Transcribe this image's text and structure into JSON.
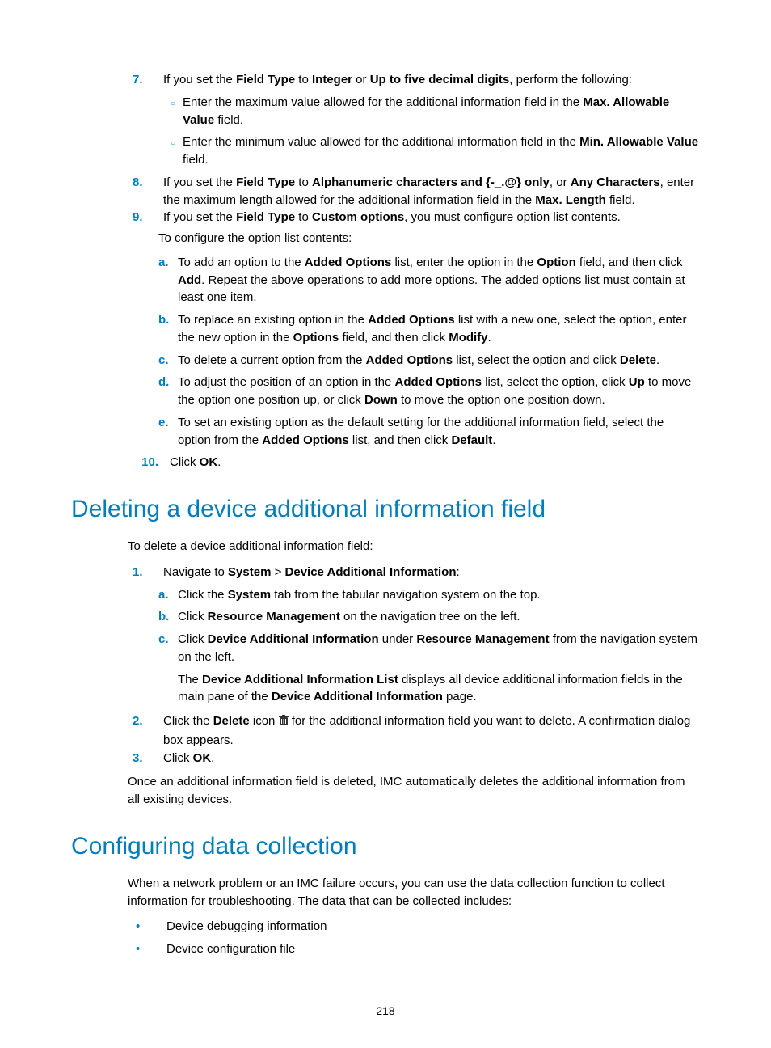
{
  "page_number": "218",
  "step7": {
    "num": "7.",
    "text_pre": "If you set the ",
    "b1": "Field Type",
    "text_mid1": " to ",
    "b2": "Integer",
    "text_mid2": " or ",
    "b3": "Up to five decimal digits",
    "text_post": ", perform the following:",
    "sub_a_pre": "Enter the maximum value allowed for the additional information field in the ",
    "sub_a_b": "Max. Allowable Value",
    "sub_a_post": " field.",
    "sub_b_pre": "Enter the minimum value allowed for the additional information field in the ",
    "sub_b_b": "Min. Allowable Value",
    "sub_b_post": " field."
  },
  "step8": {
    "num": "8.",
    "pre": "If you set the ",
    "b1": "Field Type",
    "mid1": " to ",
    "b2": "Alphanumeric characters and {-_.@} only",
    "mid2": ", or ",
    "b3": "Any Characters",
    "mid3": ", enter the maximum length allowed for the additional information field in the ",
    "b4": "Max. Length",
    "post": " field."
  },
  "step9": {
    "num": "9.",
    "pre": "If you set the ",
    "b1": "Field Type",
    "mid": " to ",
    "b2": "Custom options",
    "post": ", you must configure option list contents.",
    "intro": "To configure the option list contents:",
    "a": {
      "m": "a.",
      "t1": "To add an option to the ",
      "b1": "Added Options",
      "t2": " list, enter the option in the ",
      "b2": "Option",
      "t3": " field, and then click ",
      "b3": "Add",
      "t4": ". Repeat the above operations to add more options. The added options list must contain at least one item."
    },
    "b": {
      "m": "b.",
      "t1": "To replace an existing option in the ",
      "b1": "Added Options",
      "t2": " list with a new one, select the option, enter the new option in the ",
      "b2": "Options",
      "t3": " field, and then click ",
      "b3": "Modify",
      "t4": "."
    },
    "c": {
      "m": "c.",
      "t1": "To delete a current option from the ",
      "b1": "Added Options",
      "t2": " list, select the option and click ",
      "b2": "Delete",
      "t3": "."
    },
    "d": {
      "m": "d.",
      "t1": "To adjust the position of an option in the ",
      "b1": "Added Options",
      "t2": " list, select the option, click ",
      "b2": "Up",
      "t3": " to move the option one position up, or click ",
      "b3": "Down",
      "t4": " to move the option one position down."
    },
    "e": {
      "m": "e.",
      "t1": "To set an existing option as the default setting for the additional information field, select the option from the ",
      "b1": "Added Options",
      "t2": " list, and then click ",
      "b2": "Default",
      "t3": "."
    }
  },
  "step10": {
    "num": "10.",
    "pre": "Click ",
    "b1": "OK",
    "post": "."
  },
  "h2_delete": "Deleting a device additional information field",
  "del_intro": "To delete a device additional information field:",
  "del1": {
    "num": "1.",
    "pre": "Navigate to ",
    "b1": "System",
    "gt": " > ",
    "b2": "Device Additional Information",
    "post": ":",
    "a": {
      "m": "a.",
      "t1": "Click the ",
      "b1": "System",
      "t2": " tab from the tabular navigation system on the top."
    },
    "b": {
      "m": "b.",
      "t1": "Click ",
      "b1": "Resource Management",
      "t2": " on the navigation tree on the left."
    },
    "c": {
      "m": "c.",
      "t1": "Click ",
      "b1": "Device Additional Information",
      "t2": " under ",
      "b2": "Resource Management",
      "t3": " from the navigation system on the left."
    },
    "note_pre": "The ",
    "note_b1": "Device Additional Information List",
    "note_mid": " displays all device additional information fields in the main pane of the ",
    "note_b2": "Device Additional Information",
    "note_post": " page."
  },
  "del2": {
    "num": "2.",
    "pre": "Click the ",
    "b1": "Delete",
    "mid": " icon ",
    "post": " for the additional information field you want to delete. A confirmation dialog box appears."
  },
  "del3": {
    "num": "3.",
    "pre": "Click ",
    "b1": "OK",
    "post": "."
  },
  "del_out": "Once an additional information field is deleted, IMC automatically deletes the additional information from all existing devices.",
  "h2_config": "Configuring data collection",
  "cfg_intro": "When a network problem or an IMC failure occurs, you can use the data collection function to collect information for troubleshooting. The data that can be collected includes:",
  "cfg_b1": "Device debugging information",
  "cfg_b2": "Device configuration file"
}
